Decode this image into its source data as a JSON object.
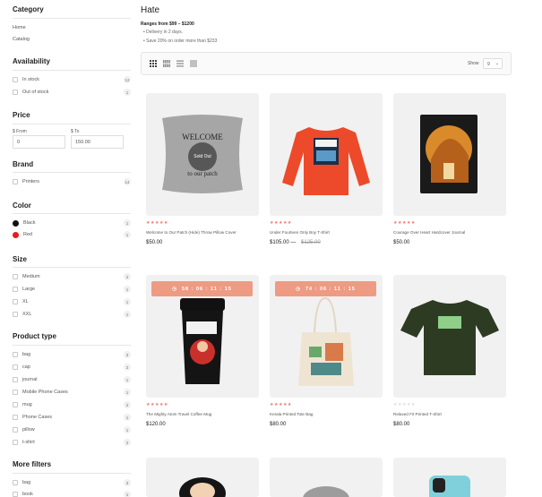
{
  "sidebar": {
    "category": {
      "title": "Category",
      "links": [
        "Home",
        "Catalog"
      ]
    },
    "availability": {
      "title": "Availability",
      "items": [
        {
          "label": "In stock",
          "count": "12"
        },
        {
          "label": "Out of stock",
          "count": "1"
        }
      ]
    },
    "price": {
      "title": "Price",
      "from_label": "$ From",
      "to_label": "$ To",
      "from_value": "0",
      "to_value": "150.00"
    },
    "brand": {
      "title": "Brand",
      "items": [
        {
          "label": "Printers",
          "count": "14"
        }
      ]
    },
    "color": {
      "title": "Color",
      "items": [
        {
          "label": "Black",
          "count": "1",
          "swatch": "#111111"
        },
        {
          "label": "Red",
          "count": "1",
          "swatch": "#e02020"
        }
      ]
    },
    "size": {
      "title": "Size",
      "items": [
        {
          "label": "Medium",
          "count": "2"
        },
        {
          "label": "Large",
          "count": "1"
        },
        {
          "label": "XL",
          "count": "1"
        },
        {
          "label": "XXL",
          "count": "1"
        }
      ]
    },
    "product_type": {
      "title": "Product type",
      "items": [
        {
          "label": "bag",
          "count": "3"
        },
        {
          "label": "cap",
          "count": "2"
        },
        {
          "label": "journal",
          "count": "1"
        },
        {
          "label": "Mobile Phone Cases",
          "count": "1"
        },
        {
          "label": "mug",
          "count": "2"
        },
        {
          "label": "Phone Cases",
          "count": "1"
        },
        {
          "label": "pillow",
          "count": "1"
        },
        {
          "label": "t-shirt",
          "count": "2"
        }
      ]
    },
    "more_filters": {
      "title": "More filters",
      "items": [
        {
          "label": "bag",
          "count": "3"
        },
        {
          "label": "book",
          "count": "1"
        }
      ]
    }
  },
  "main": {
    "title": "Hate",
    "range_text": "Ranges from $99 – $1200",
    "bullets": [
      "Delivery in 2 days.",
      "Save 20% on order more than $233"
    ],
    "toolbar": {
      "show_label": "Show",
      "show_value": "9",
      "view_icons": [
        "grid-3-icon",
        "grid-4-icon",
        "list-icon",
        "list-detail-icon"
      ]
    }
  },
  "accent_color": "#ee9b84",
  "products": [
    {
      "name": "Welcome to Our Patch (Hide) Throw Pillow Cover",
      "price": "$50.00",
      "old_price": "",
      "rating": 5,
      "badge": "Sold Out",
      "timer": ""
    },
    {
      "name": "Under Fourteen Only Boy T-Shirt",
      "price": "$105.00",
      "old_price": "$125.00",
      "rating": 5,
      "badge": "",
      "timer": ""
    },
    {
      "name": "Courage Over Heart Hardcover Journal",
      "price": "$50.00",
      "old_price": "",
      "rating": 5,
      "badge": "",
      "timer": ""
    },
    {
      "name": "The Mighty Atom Travel Coffee Mug",
      "price": "$120.00",
      "old_price": "",
      "rating": 5,
      "badge": "",
      "timer": "58 : 06 : 11 : 15"
    },
    {
      "name": "Kerala Printed Tote Bag",
      "price": "$80.00",
      "old_price": "",
      "rating": 5,
      "badge": "",
      "timer": "74 : 06 : 11 : 15"
    },
    {
      "name": "Relaxed Fit Printed T-Shirt",
      "price": "$80.00",
      "old_price": "",
      "rating": 0,
      "badge": "",
      "timer": ""
    }
  ]
}
